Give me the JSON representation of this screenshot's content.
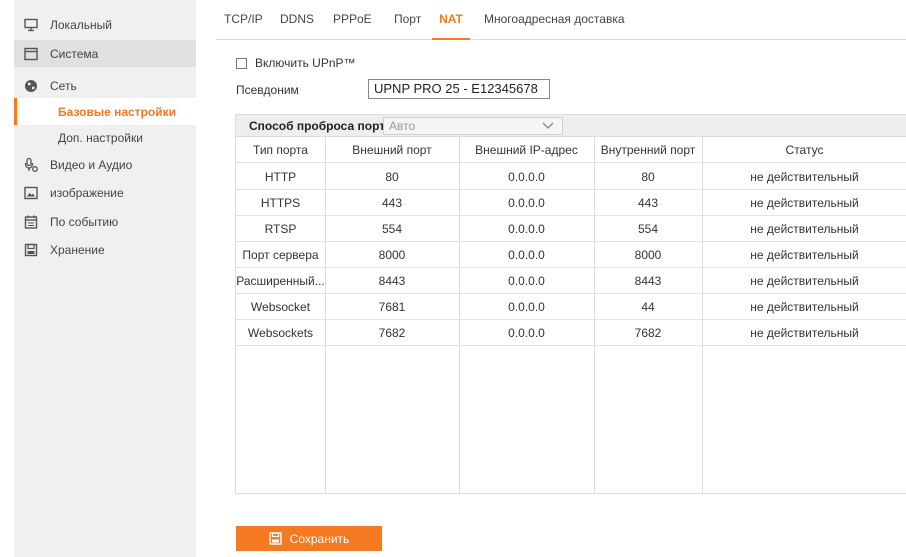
{
  "sidebar": {
    "items": [
      {
        "label": "Локальный",
        "icon": "monitor-icon"
      },
      {
        "label": "Система",
        "icon": "system-icon"
      },
      {
        "label": "Сеть",
        "icon": "globe-icon"
      },
      {
        "label": "Видео и Аудио",
        "icon": "video-audio-icon"
      },
      {
        "label": "изображение",
        "icon": "image-icon"
      },
      {
        "label": "По событию",
        "icon": "calendar-icon"
      },
      {
        "label": "Хранение",
        "icon": "storage-icon"
      }
    ],
    "sub_items": [
      {
        "label": "Базовые настройки"
      },
      {
        "label": "Доп. настройки"
      }
    ]
  },
  "tabs": [
    {
      "label": "TCP/IP"
    },
    {
      "label": "DDNS"
    },
    {
      "label": "PPPoE"
    },
    {
      "label": "Порт"
    },
    {
      "label": "NAT"
    },
    {
      "label": "Многоадресная доставка"
    }
  ],
  "upnp": {
    "label": "Включить UPnP™",
    "checked": false
  },
  "alias": {
    "label": "Псевдоним",
    "value": "UPNP PRO 25 - E12345678"
  },
  "port_mapping": {
    "label": "Способ проброса порт...",
    "value": "Авто"
  },
  "table": {
    "columns": [
      "Тип порта",
      "Внешний порт",
      "Внешний IP-адрес",
      "Внутренний порт",
      "Статус"
    ],
    "rows": [
      [
        "HTTP",
        "80",
        "0.0.0.0",
        "80",
        "не действительный"
      ],
      [
        "HTTPS",
        "443",
        "0.0.0.0",
        "443",
        "не действительный"
      ],
      [
        "RTSP",
        "554",
        "0.0.0.0",
        "554",
        "не действительный"
      ],
      [
        "Порт сервера",
        "8000",
        "0.0.0.0",
        "8000",
        "не действительный"
      ],
      [
        "Расширенный...",
        "8443",
        "0.0.0.0",
        "8443",
        "не действительный"
      ],
      [
        "Websocket",
        "7681",
        "0.0.0.0",
        "44",
        "не действительный"
      ],
      [
        "Websockets",
        "7682",
        "0.0.0.0",
        "7682",
        "не действительный"
      ]
    ]
  },
  "save_button": {
    "label": "Сохранить"
  },
  "colors": {
    "accent": "#f47920",
    "sidebar_bg": "#f0f0f0"
  }
}
